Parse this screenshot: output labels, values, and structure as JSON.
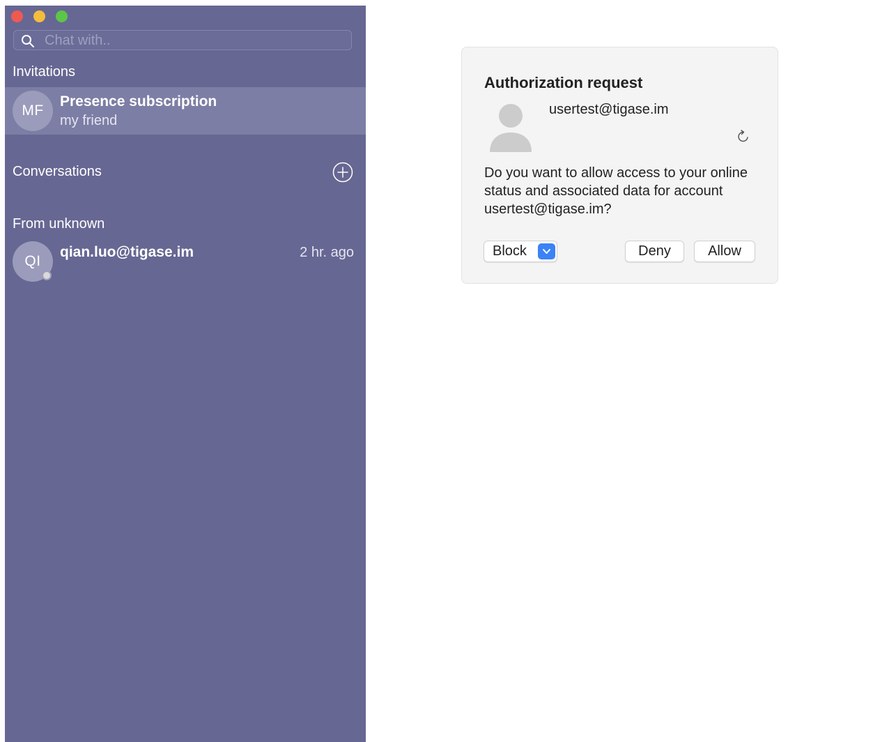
{
  "sidebar": {
    "search": {
      "placeholder": "Chat with..",
      "value": ""
    },
    "invitations": {
      "title": "Invitations",
      "items": [
        {
          "initials": "MF",
          "title": "Presence subscription",
          "subtitle": "my friend",
          "selected": true
        }
      ]
    },
    "conversations": {
      "title": "Conversations",
      "add_icon": "plus-circle-icon"
    },
    "from_unknown": {
      "title": "From unknown",
      "items": [
        {
          "initials": "QI",
          "name": "qian.luo@tigase.im",
          "time": "2 hr. ago",
          "status": "offline"
        }
      ]
    }
  },
  "authorization": {
    "title": "Authorization request",
    "jid": "usertest@tigase.im",
    "message": "Do you want to allow access to your online status and associated data for account usertest@tigase.im?",
    "block_label": "Block",
    "deny_label": "Deny",
    "allow_label": "Allow"
  },
  "colors": {
    "sidebar_bg": "#676793",
    "selected_row": "#7d7ea5",
    "accent": "#3b82f6",
    "close": "#ee5a52",
    "minimize": "#f3bd3d",
    "maximize": "#5cc648"
  }
}
